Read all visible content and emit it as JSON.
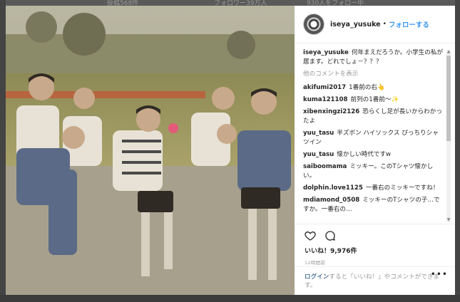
{
  "background": {
    "top_texts": [
      "投稿568件",
      "フォロワー39万人",
      "930人をフォロー中"
    ]
  },
  "post": {
    "username": "iseya_yusuke",
    "separator": "•",
    "follow_label": "フォローする",
    "caption_user": "iseya_yusuke",
    "caption_text": "何年まえだろうか。小学生の私が居ます。どれでしょ－？？？",
    "more_comments_label": "他のコメントを表示",
    "comments": [
      {
        "user": "akifumi2017",
        "text": "1番前の右👆"
      },
      {
        "user": "kuma121108",
        "text": "前列の1番前〜✨"
      },
      {
        "user": "xibenxingzi2126",
        "text": "恐らくし足が長いからわかったよ"
      },
      {
        "user": "yuu_tasu",
        "text": "半ズボン ハイソックス ぴっちりシャツイン"
      },
      {
        "user": "yuu_tasu",
        "text": "懐かしい時代ですw"
      },
      {
        "user": "saiboomama",
        "text": "ミッキー。このTシャツ懐かしい。"
      },
      {
        "user": "dolphin.love1125",
        "text": "一番右のミッキーですね！"
      },
      {
        "user": "mdiamond_0508",
        "text": "ミッキーのTシャツの子…ですか。一番右の…"
      }
    ],
    "likes_label": "いいね！9,976件",
    "time_label": "12時間前",
    "login_prefix": "ログイン",
    "login_suffix": "すると「いいね！」やコメントができます。",
    "more_options": "•••"
  },
  "icons": {
    "heart": "heart-icon",
    "comment": "comment-icon",
    "avatar": "avatar"
  },
  "colors": {
    "link": "#3897f0",
    "text": "#262626",
    "muted": "#999999"
  }
}
